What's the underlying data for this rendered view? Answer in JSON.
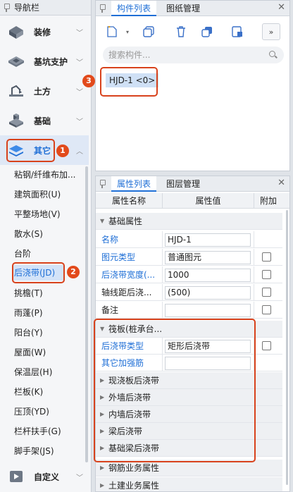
{
  "nav": {
    "title": "导航栏",
    "categories": [
      {
        "label": "装修",
        "icon": "decoration-icon"
      },
      {
        "label": "基坑支护",
        "icon": "pit-support-icon"
      },
      {
        "label": "土方",
        "icon": "earthwork-icon"
      },
      {
        "label": "基础",
        "icon": "foundation-icon"
      },
      {
        "label": "其它",
        "icon": "other-layers-icon",
        "expanded": true
      },
      {
        "label": "自定义",
        "icon": "custom-icon"
      }
    ],
    "items": [
      "粘钢/纤维布加...",
      "建筑面积(U)",
      "平整场地(V)",
      "散水(S)",
      "台阶",
      "后浇带(JD)",
      "挑檐(T)",
      "雨蓬(P)",
      "阳台(Y)",
      "屋面(W)",
      "保温层(H)",
      "栏板(K)",
      "压顶(YD)",
      "栏杆扶手(G)",
      "脚手架(JS)"
    ],
    "selected_item": "后浇带(JD)"
  },
  "components": {
    "tabs": [
      "构件列表",
      "图纸管理"
    ],
    "active_tab": "构件列表",
    "search_placeholder": "搜索构件...",
    "items": [
      "HJD-1 <0>"
    ]
  },
  "properties": {
    "tabs": [
      "属性列表",
      "图层管理"
    ],
    "active_tab": "属性列表",
    "columns": [
      "属性名称",
      "属性值",
      "附加"
    ],
    "basic_group": "基础属性",
    "basic_rows": [
      {
        "name": "名称",
        "value": "HJD-1",
        "blue": true,
        "checkbox": false
      },
      {
        "name": "图元类型",
        "value": "普通图元",
        "blue": true,
        "checkbox": true
      },
      {
        "name": "后浇带宽度(...",
        "value": "1000",
        "blue": true,
        "checkbox": true
      },
      {
        "name": "轴线距后浇...",
        "value": "(500)",
        "blue": false,
        "checkbox": true
      },
      {
        "name": "备注",
        "value": "",
        "blue": false,
        "checkbox": true
      }
    ],
    "raft_group": "筏板(桩承台...",
    "raft_rows": [
      {
        "name": "后浇带类型",
        "value": "矩形后浇带",
        "blue": true,
        "checkbox": true
      },
      {
        "name": "其它加强筋",
        "value": "",
        "blue": true,
        "checkbox": false
      }
    ],
    "collapsed_groups": [
      "现浇板后浇带",
      "外墙后浇带",
      "内墙后浇带",
      "梁后浇带",
      "基础梁后浇带",
      "钢筋业务属性",
      "土建业务属性"
    ]
  },
  "annotations": [
    "1",
    "2",
    "3"
  ],
  "colors": {
    "accent": "#1f6fd6",
    "annotation": "#d8421c"
  }
}
